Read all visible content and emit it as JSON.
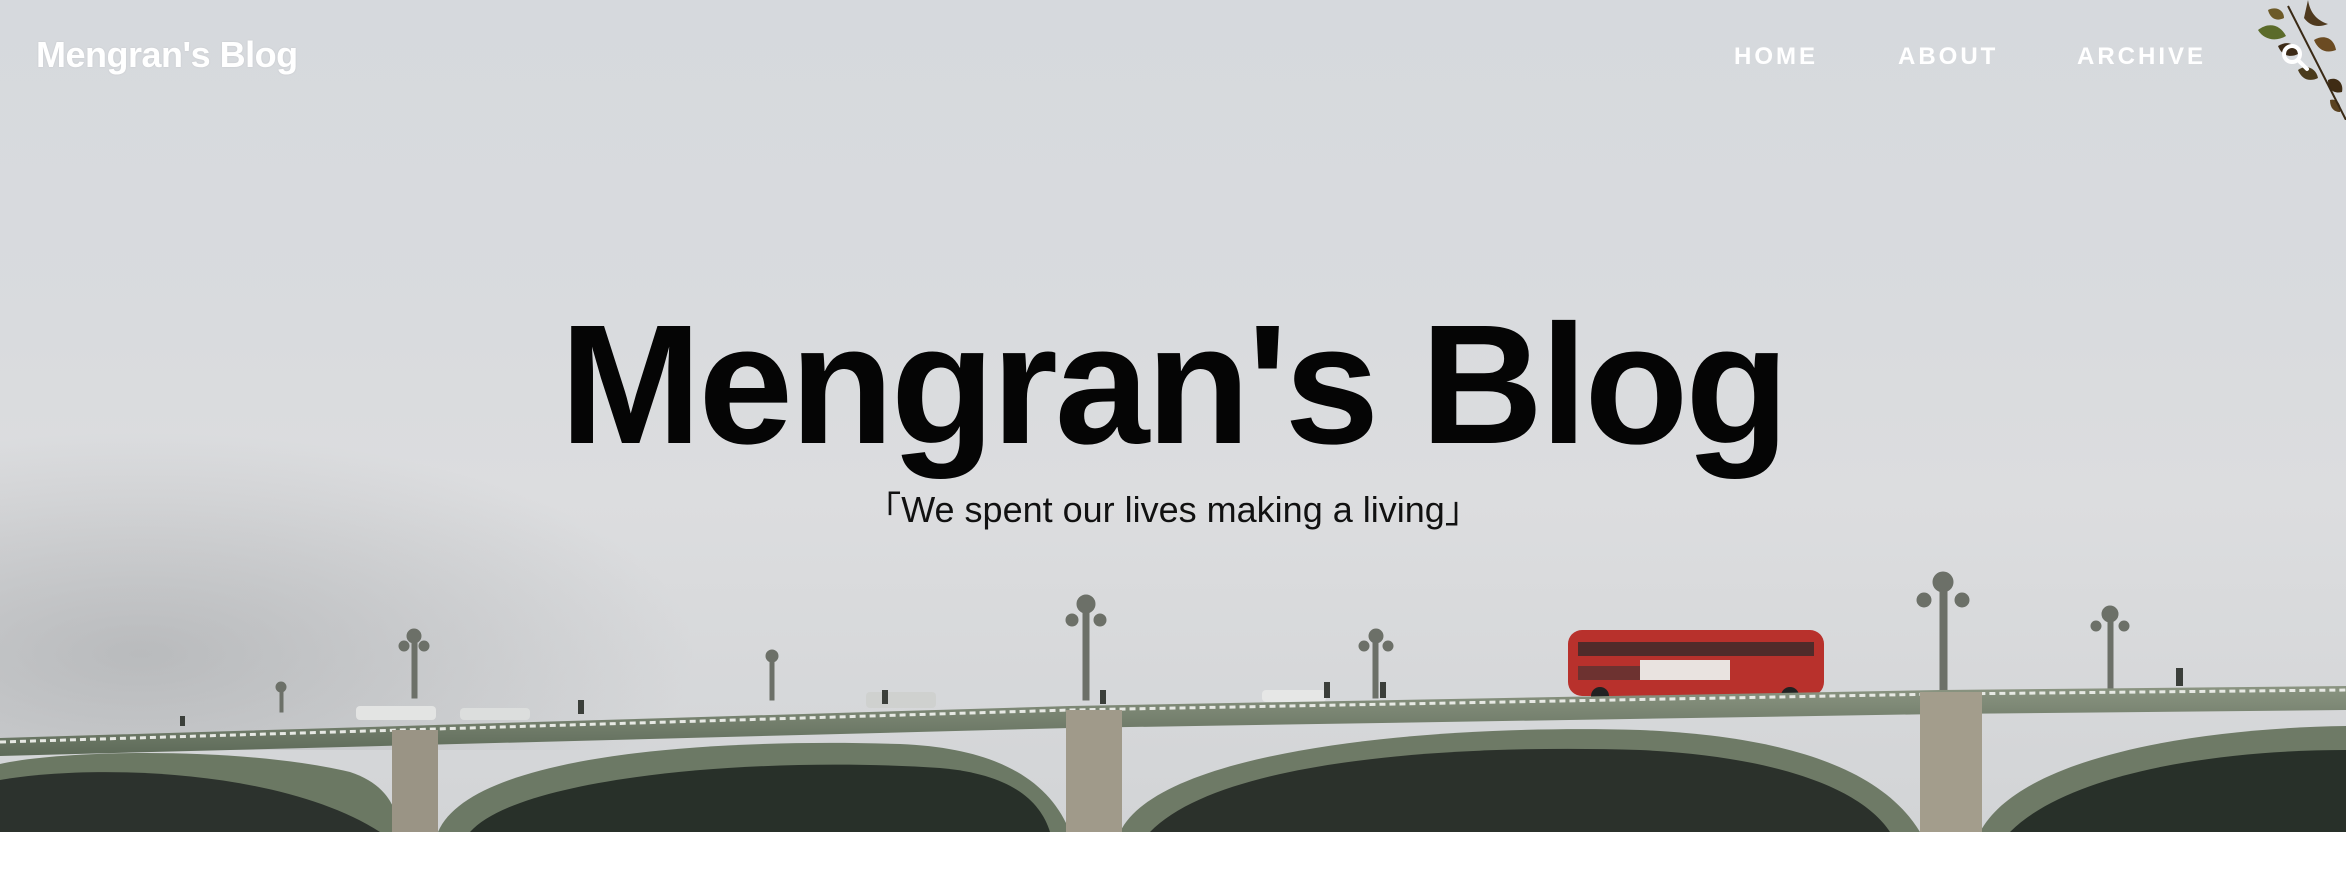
{
  "site": {
    "brand": "Mengran's Blog"
  },
  "nav": {
    "items": [
      {
        "label": "HOME"
      },
      {
        "label": "ABOUT"
      },
      {
        "label": "ARCHIVE"
      }
    ],
    "search_icon": "search-icon"
  },
  "hero": {
    "title": "Mengran's Blog",
    "subtitle": "「We spent our lives making a living」",
    "background": "foggy-westminster-bridge-with-red-double-decker-bus"
  },
  "colors": {
    "nav_text": "#ffffff",
    "title_text": "#050505",
    "bridge_green": "#6e7a66",
    "bus_red": "#b8312c"
  }
}
